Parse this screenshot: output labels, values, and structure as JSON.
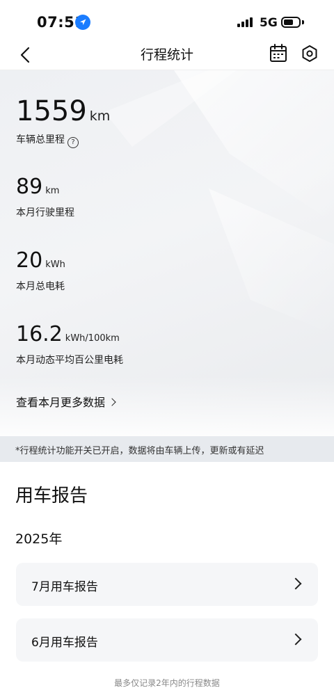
{
  "status_bar": {
    "time": "07:51",
    "network": "5G",
    "location_icon": "location-arrow-icon",
    "signal_icon": "cellular-signal-icon",
    "battery_icon": "battery-icon"
  },
  "nav": {
    "title": "行程统计",
    "back_icon": "chevron-left-icon",
    "calendar_icon": "calendar-icon",
    "settings_icon": "hexagon-settings-icon"
  },
  "stats": {
    "total_mileage": {
      "value": "1559",
      "unit": "km",
      "label": "车辆总里程",
      "help_glyph": "?"
    },
    "month_mileage": {
      "value": "89",
      "unit": "km",
      "label": "本月行驶里程"
    },
    "month_energy": {
      "value": "20",
      "unit": "kWh",
      "label": "本月总电耗"
    },
    "month_avg_consumption": {
      "value": "16.2",
      "unit": "kWh/100km",
      "label": "本月动态平均百公里电耗"
    }
  },
  "more_link": {
    "label": "查看本月更多数据"
  },
  "notice": {
    "text": "*行程统计功能开关已开启，数据将由车辆上传，更新或有延迟"
  },
  "report": {
    "title": "用车报告",
    "year": "2025年",
    "items": [
      {
        "label": "7月用车报告"
      },
      {
        "label": "6月用车报告"
      }
    ]
  },
  "footer": {
    "text": "最多仅记录2年内的行程数据"
  },
  "colors": {
    "accent_blue": "#1a7cff",
    "hero_bg": "#eef0f3",
    "notice_bg": "#e7eaee",
    "card_bg": "#f5f6f8",
    "footer_text": "#888888"
  }
}
